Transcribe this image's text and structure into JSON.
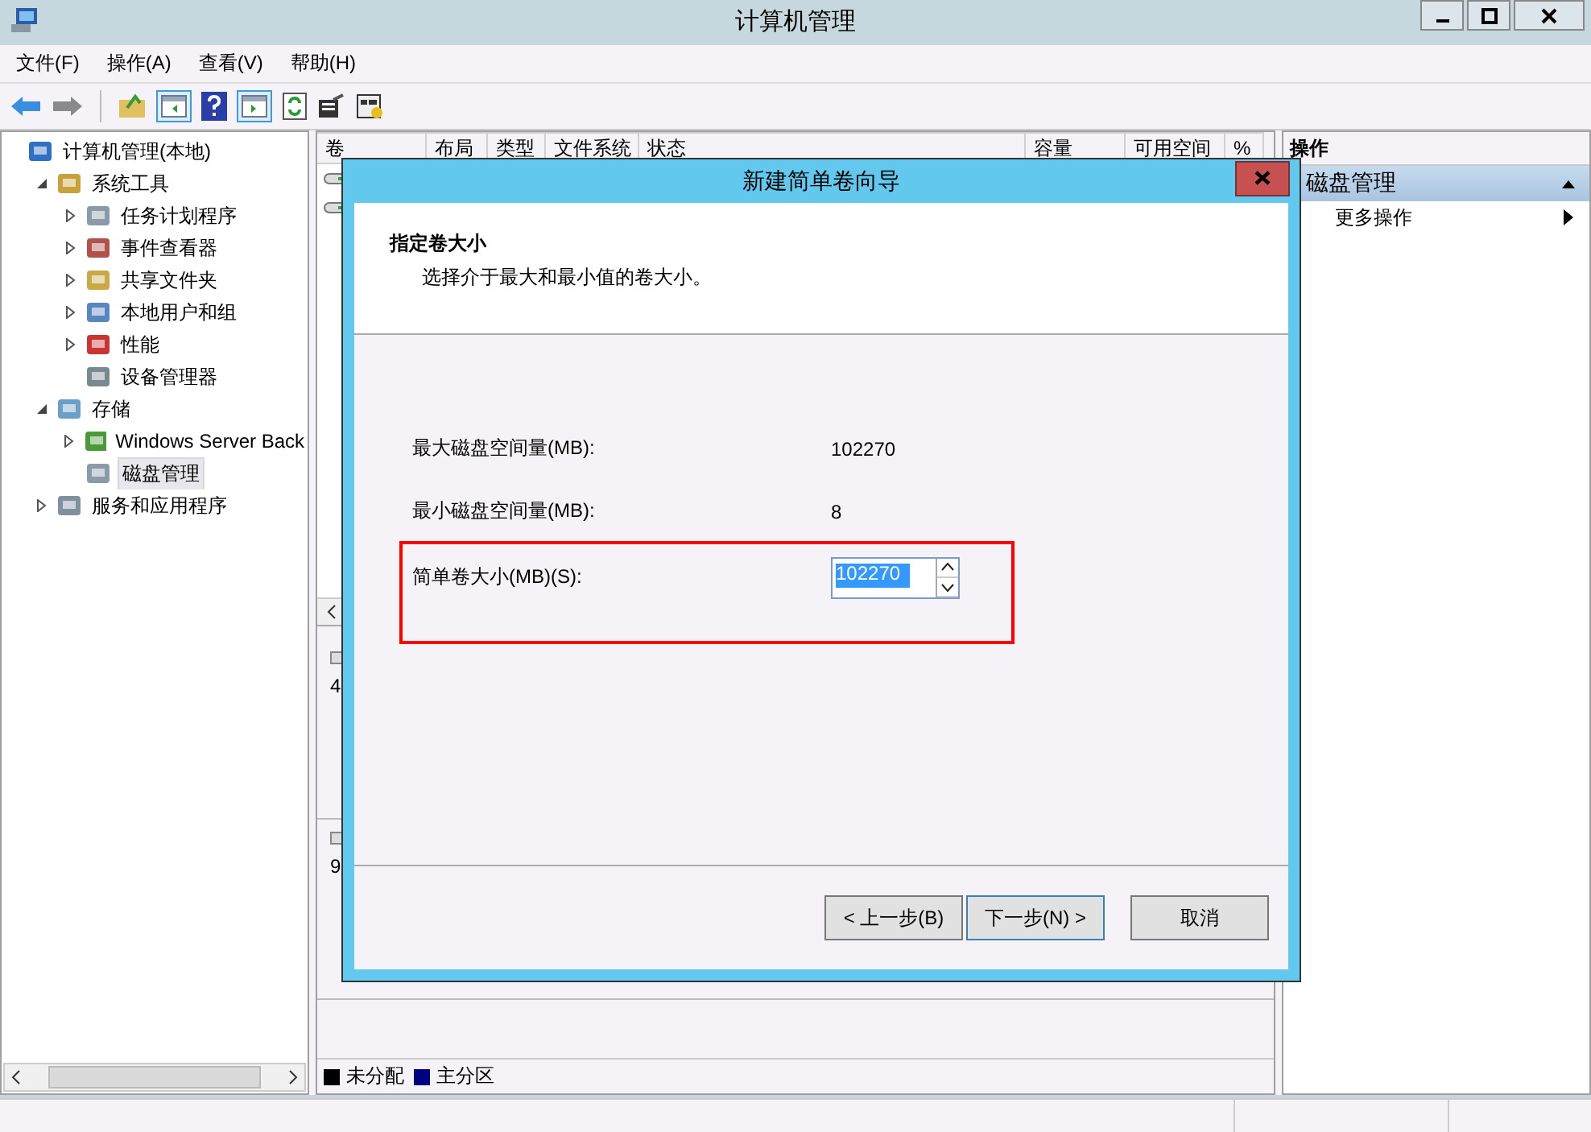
{
  "window": {
    "title": "计算机管理"
  },
  "menu": [
    "文件(F)",
    "操作(A)",
    "查看(V)",
    "帮助(H)"
  ],
  "toolbar": {
    "console_tree_toggle": {
      "on": true
    },
    "action_pane_toggle": {
      "on": true
    }
  },
  "tree": [
    {
      "label": "计算机管理(本地)",
      "selected": false,
      "children": [
        {
          "label": "系统工具",
          "expanded": true,
          "selected": false,
          "children": [
            {
              "label": "任务计划程序",
              "expanded": false,
              "selected": false
            },
            {
              "label": "事件查看器",
              "expanded": false,
              "selected": false
            },
            {
              "label": "共享文件夹",
              "expanded": false,
              "selected": false
            },
            {
              "label": "本地用户和组",
              "expanded": false,
              "selected": false
            },
            {
              "label": "性能",
              "expanded": false,
              "selected": false
            },
            {
              "label": "设备管理器",
              "selected": false
            }
          ]
        },
        {
          "label": "存储",
          "expanded": true,
          "selected": false,
          "children": [
            {
              "label": "Windows Server Back",
              "expanded": false,
              "selected": false
            },
            {
              "label": "磁盘管理",
              "selected": true
            }
          ]
        },
        {
          "label": "服务和应用程序",
          "expanded": false,
          "selected": false
        }
      ]
    }
  ],
  "volume_table": {
    "columns": [
      "卷",
      "布局",
      "类型",
      "文件系统",
      "状态",
      "容量",
      "可用空间",
      "%"
    ]
  },
  "disks": [
    {
      "size_fragment": "4"
    },
    {
      "size_fragment": "9"
    }
  ],
  "legend": [
    {
      "label": "未分配",
      "color": "#000000"
    },
    {
      "label": "主分区",
      "color": "#000080"
    }
  ],
  "actions": {
    "title": "操作",
    "section": {
      "label": "磁盘管理",
      "expanded": true
    },
    "items": [
      {
        "label": "更多操作"
      }
    ]
  },
  "dialog": {
    "title": "新建简单卷向导",
    "heading": "指定卷大小",
    "subtitle": "选择介于最大和最小值的卷大小。",
    "fields": [
      {
        "kind": "readout",
        "label": "最大磁盘空间量(MB):",
        "value": "102270"
      },
      {
        "kind": "readout",
        "label": "最小磁盘空间量(MB):",
        "value": "8"
      },
      {
        "kind": "spinner",
        "label": "简单卷大小(MB)(S):",
        "value": "102270",
        "selected": true,
        "highlighted": true
      }
    ],
    "buttons": [
      {
        "label": "< 上一步(B)",
        "default": false
      },
      {
        "label": "下一步(N) >",
        "default": true
      },
      {
        "label": "取消",
        "default": false
      }
    ]
  }
}
